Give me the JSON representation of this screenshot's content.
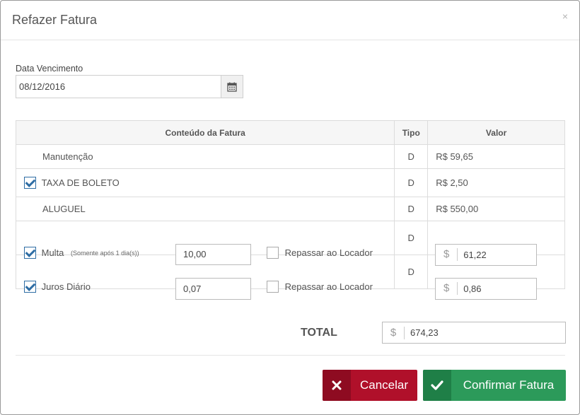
{
  "modal": {
    "title": "Refazer Fatura",
    "close_glyph": "×"
  },
  "due_date": {
    "label": "Data Vencimento",
    "value": "08/12/2016",
    "button_icon": "calendar-icon"
  },
  "table": {
    "headers": {
      "content": "Conteúdo da Fatura",
      "type": "Tipo",
      "value": "Valor"
    },
    "rows": [
      {
        "desc": "Manutenção",
        "tipo": "D",
        "valor": "R$ 59,65"
      },
      {
        "desc": "TAXA DE BOLETO",
        "tipo": "D",
        "valor": "R$ 2,50",
        "checked": true
      },
      {
        "desc": "ALUGUEL",
        "tipo": "D",
        "valor": "R$ 550,00"
      }
    ],
    "multa": {
      "label": "Multa",
      "note": "(Somente após 1 dia(s))",
      "input": "10,00",
      "repassar": "Repassar ao Locador",
      "tipo": "D",
      "currency": "$",
      "valor": "61,22",
      "checked": true,
      "repassar_checked": false
    },
    "juros": {
      "label": "Juros Diário",
      "input": "0,07",
      "repassar": "Repassar ao Locador",
      "tipo": "D",
      "currency": "$",
      "valor": "0,86",
      "checked": true,
      "repassar_checked": false
    }
  },
  "total": {
    "label": "TOTAL",
    "currency": "$",
    "value": "674,23"
  },
  "buttons": {
    "cancel": "Cancelar",
    "confirm": "Confirmar Fatura"
  },
  "colors": {
    "cancel_bg": "#b0102a",
    "confirm_bg": "#2c9a5a",
    "checkbox": "#2e6da4"
  }
}
